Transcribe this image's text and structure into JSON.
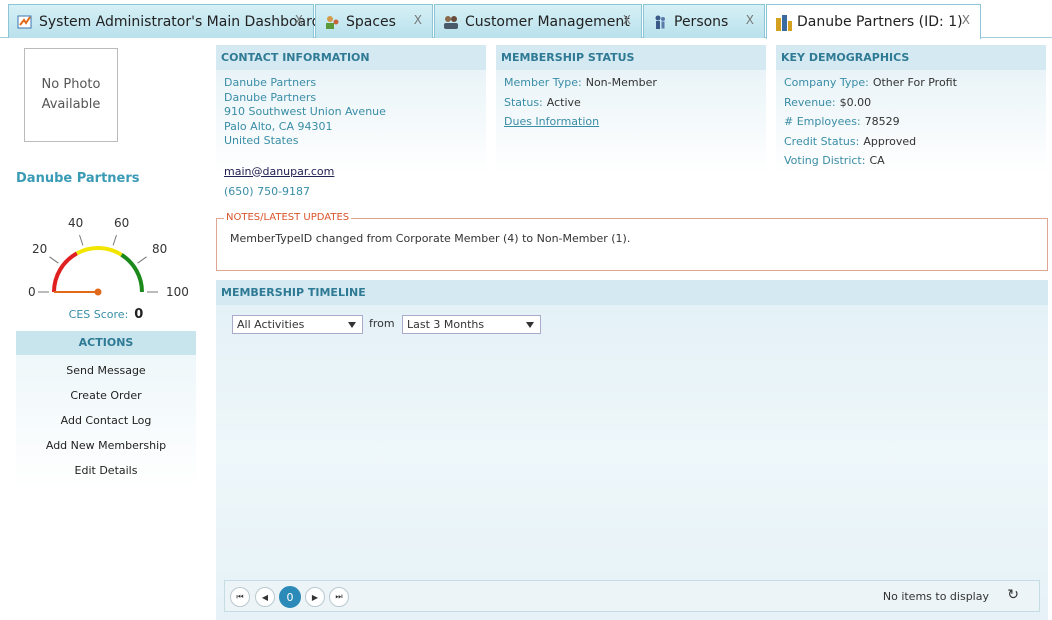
{
  "tabs": [
    {
      "label": "System Administrator's Main Dashboard",
      "icon": "dashboard-icon",
      "close": "X"
    },
    {
      "label": "Spaces",
      "icon": "spaces-icon",
      "close": "X"
    },
    {
      "label": "Customer Management",
      "icon": "customers-icon",
      "close": "X"
    },
    {
      "label": "Persons",
      "icon": "persons-icon",
      "close": "X"
    },
    {
      "label": "Danube Partners (ID: 1)",
      "icon": "organization-icon",
      "close": "X"
    }
  ],
  "profile": {
    "photo_placeholder": "No Photo Available",
    "name": "Danube Partners"
  },
  "gauge": {
    "ticks": [
      "0",
      "20",
      "40",
      "60",
      "80",
      "100"
    ],
    "value": 0,
    "colors": {
      "low": "#e02020",
      "mid": "#f2e600",
      "high": "#1b8a1b",
      "needle": "#e06a1a"
    }
  },
  "ces": {
    "label": "CES Score:",
    "value": "0"
  },
  "actions": {
    "title": "ACTIONS",
    "items": [
      "Send Message",
      "Create Order",
      "Add Contact Log",
      "Add New Membership",
      "Edit Details"
    ]
  },
  "contact": {
    "title": "CONTACT INFORMATION",
    "lines": [
      "Danube Partners",
      "Danube Partners",
      "910 Southwest Union Avenue",
      "Palo Alto, CA 94301",
      "United States"
    ],
    "email": "main@danupar.com",
    "phone": "(650) 750-9187"
  },
  "membership": {
    "title": "MEMBERSHIP STATUS",
    "member_type_label": "Member Type:",
    "member_type": "Non-Member",
    "status_label": "Status:",
    "status": "Active",
    "dues_link": "Dues Information"
  },
  "demographics": {
    "title": "KEY DEMOGRAPHICS",
    "rows": [
      {
        "k": "Company Type:",
        "v": "Other For Profit"
      },
      {
        "k": "Revenue:",
        "v": "$0.00"
      },
      {
        "k": "# Employees:",
        "v": "78529"
      },
      {
        "k": "Credit Status:",
        "v": "Approved"
      },
      {
        "k": "Voting District:",
        "v": "CA"
      }
    ]
  },
  "notes": {
    "title": "NOTES/LATEST UPDATES",
    "text": "MemberTypeID changed from Corporate Member (4) to Non-Member (1)."
  },
  "timeline": {
    "title": "MEMBERSHIP TIMELINE",
    "activity_filter": "All Activities",
    "from_label": "from",
    "range_filter": "Last 3 Months",
    "pager": {
      "current_page": "0",
      "info": "No items to display"
    }
  }
}
